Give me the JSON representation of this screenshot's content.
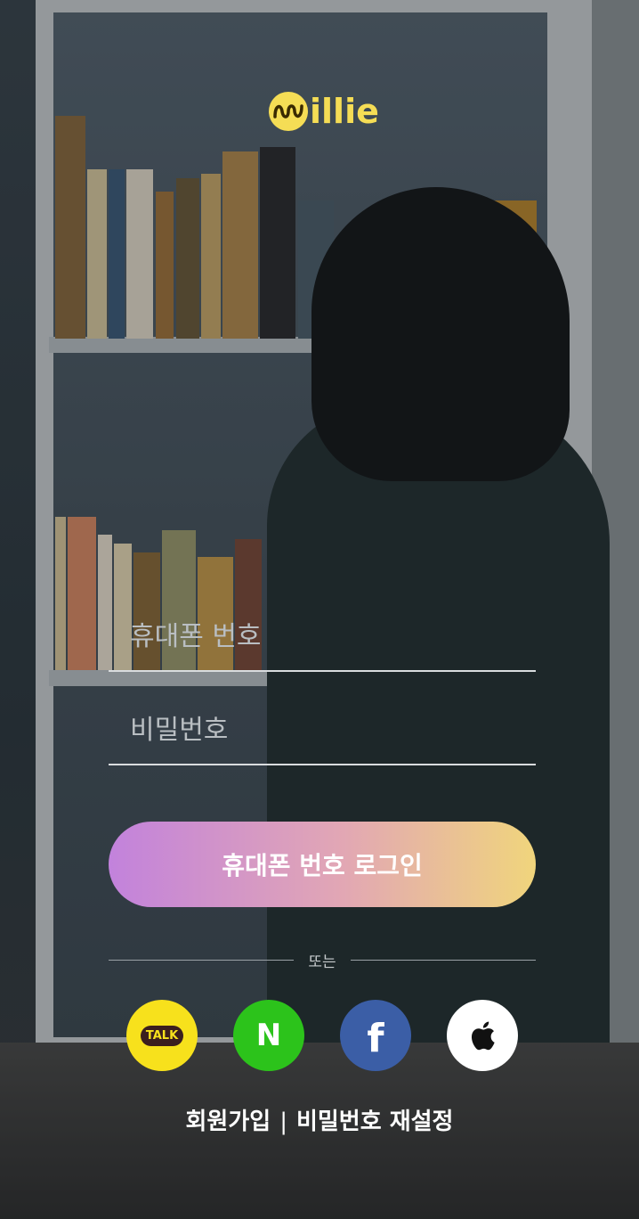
{
  "brand": {
    "name": "illie",
    "mark_color": "#f5dd55"
  },
  "form": {
    "phone_placeholder": "휴대폰 번호",
    "password_placeholder": "비밀번호",
    "login_button": "휴대폰 번호 로그인"
  },
  "divider_text": "또는",
  "social": {
    "kakao": {
      "label": "TALK",
      "icon": "kakao-talk-icon",
      "color": "#f7e11c"
    },
    "naver": {
      "label": "N",
      "icon": "naver-icon",
      "color": "#2cc31b"
    },
    "facebook": {
      "label": "f",
      "icon": "facebook-icon",
      "color": "#3b5ea6"
    },
    "apple": {
      "icon": "apple-icon",
      "color": "#ffffff"
    }
  },
  "links": {
    "signup": "회원가입",
    "separator": "|",
    "reset_password": "비밀번호 재설정"
  }
}
